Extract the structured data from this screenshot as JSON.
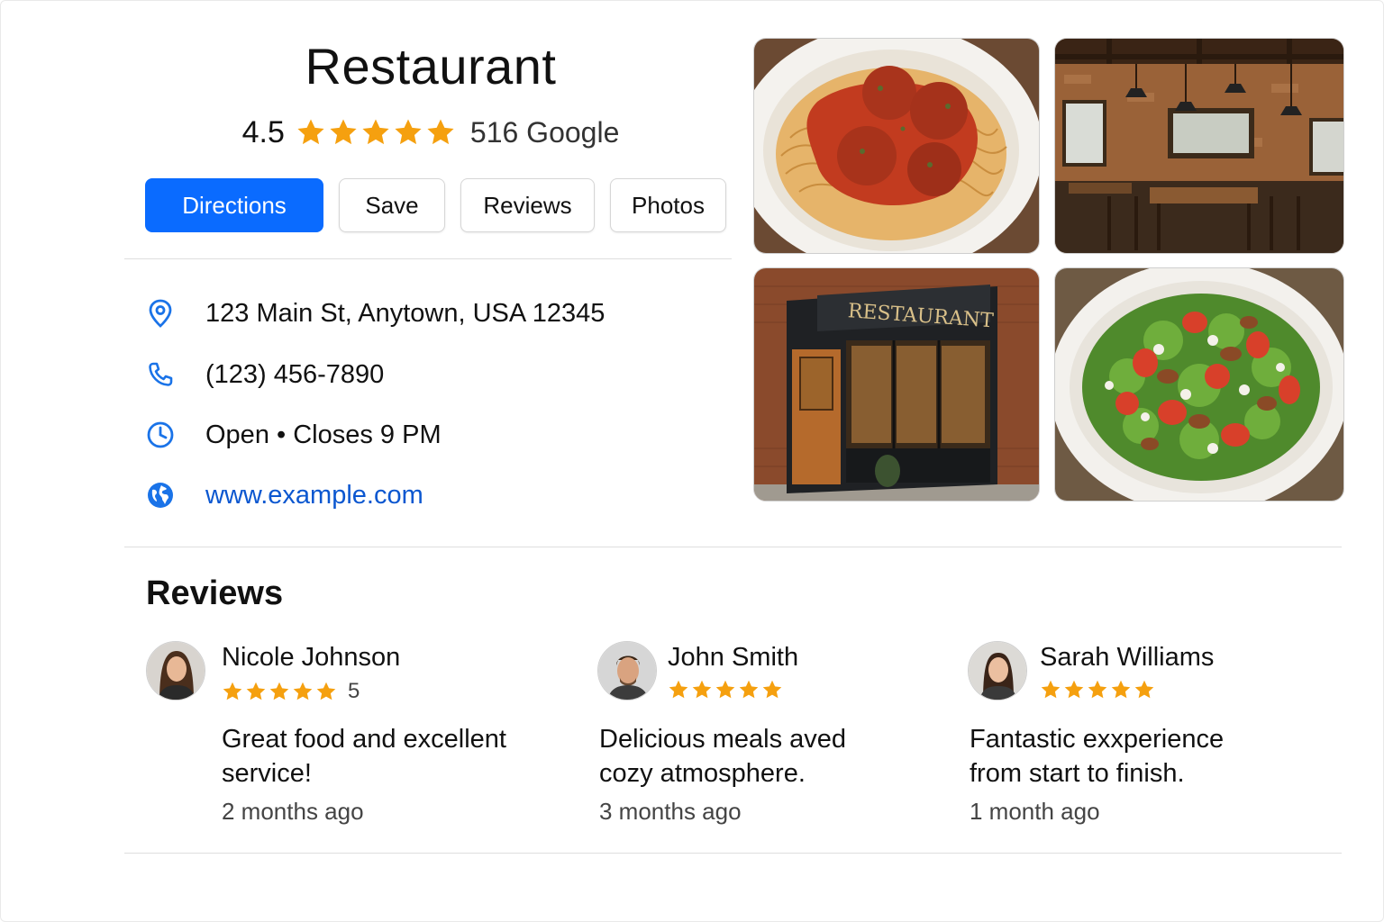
{
  "place": {
    "name": "Restaurant",
    "rating": "4.5",
    "rating_stars": 5,
    "review_count": "516 Google",
    "star_color": "#f5a00f"
  },
  "actions": {
    "directions": "Directions",
    "save": "Save",
    "reviews": "Reviews",
    "photos": "Photos",
    "accent_color": "#0a6bff"
  },
  "info": {
    "address": {
      "icon": "location-pin-icon",
      "text": "123 Main St, Anytown, USA 12345"
    },
    "phone": {
      "icon": "phone-icon",
      "text": "(123) 456-7890"
    },
    "hours": {
      "icon": "clock-icon",
      "text": "Open • Closes 9 PM"
    },
    "website": {
      "icon": "globe-icon",
      "text": "www.example.com"
    }
  },
  "photos": [
    {
      "subject": "spaghetti-and-meatballs"
    },
    {
      "subject": "restaurant-interior"
    },
    {
      "subject": "restaurant-storefront",
      "sign_text": "RESTAURANT"
    },
    {
      "subject": "salad"
    }
  ],
  "reviews_section": {
    "heading": "Reviews",
    "items": [
      {
        "name": "Nicole Johnson",
        "stars": 5,
        "rating_label": "5",
        "text": "Great food and excellent service!",
        "time": "2 months ago"
      },
      {
        "name": "John Smith",
        "stars": 5,
        "rating_label": "",
        "text": "Delicious meals aved cozy atmosphere.",
        "time": "3 months ago"
      },
      {
        "name": "Sarah Williams",
        "stars": 5,
        "rating_label": "",
        "text": "Fantastic exxperience from start to finish.",
        "time": "1 month ago"
      }
    ]
  }
}
